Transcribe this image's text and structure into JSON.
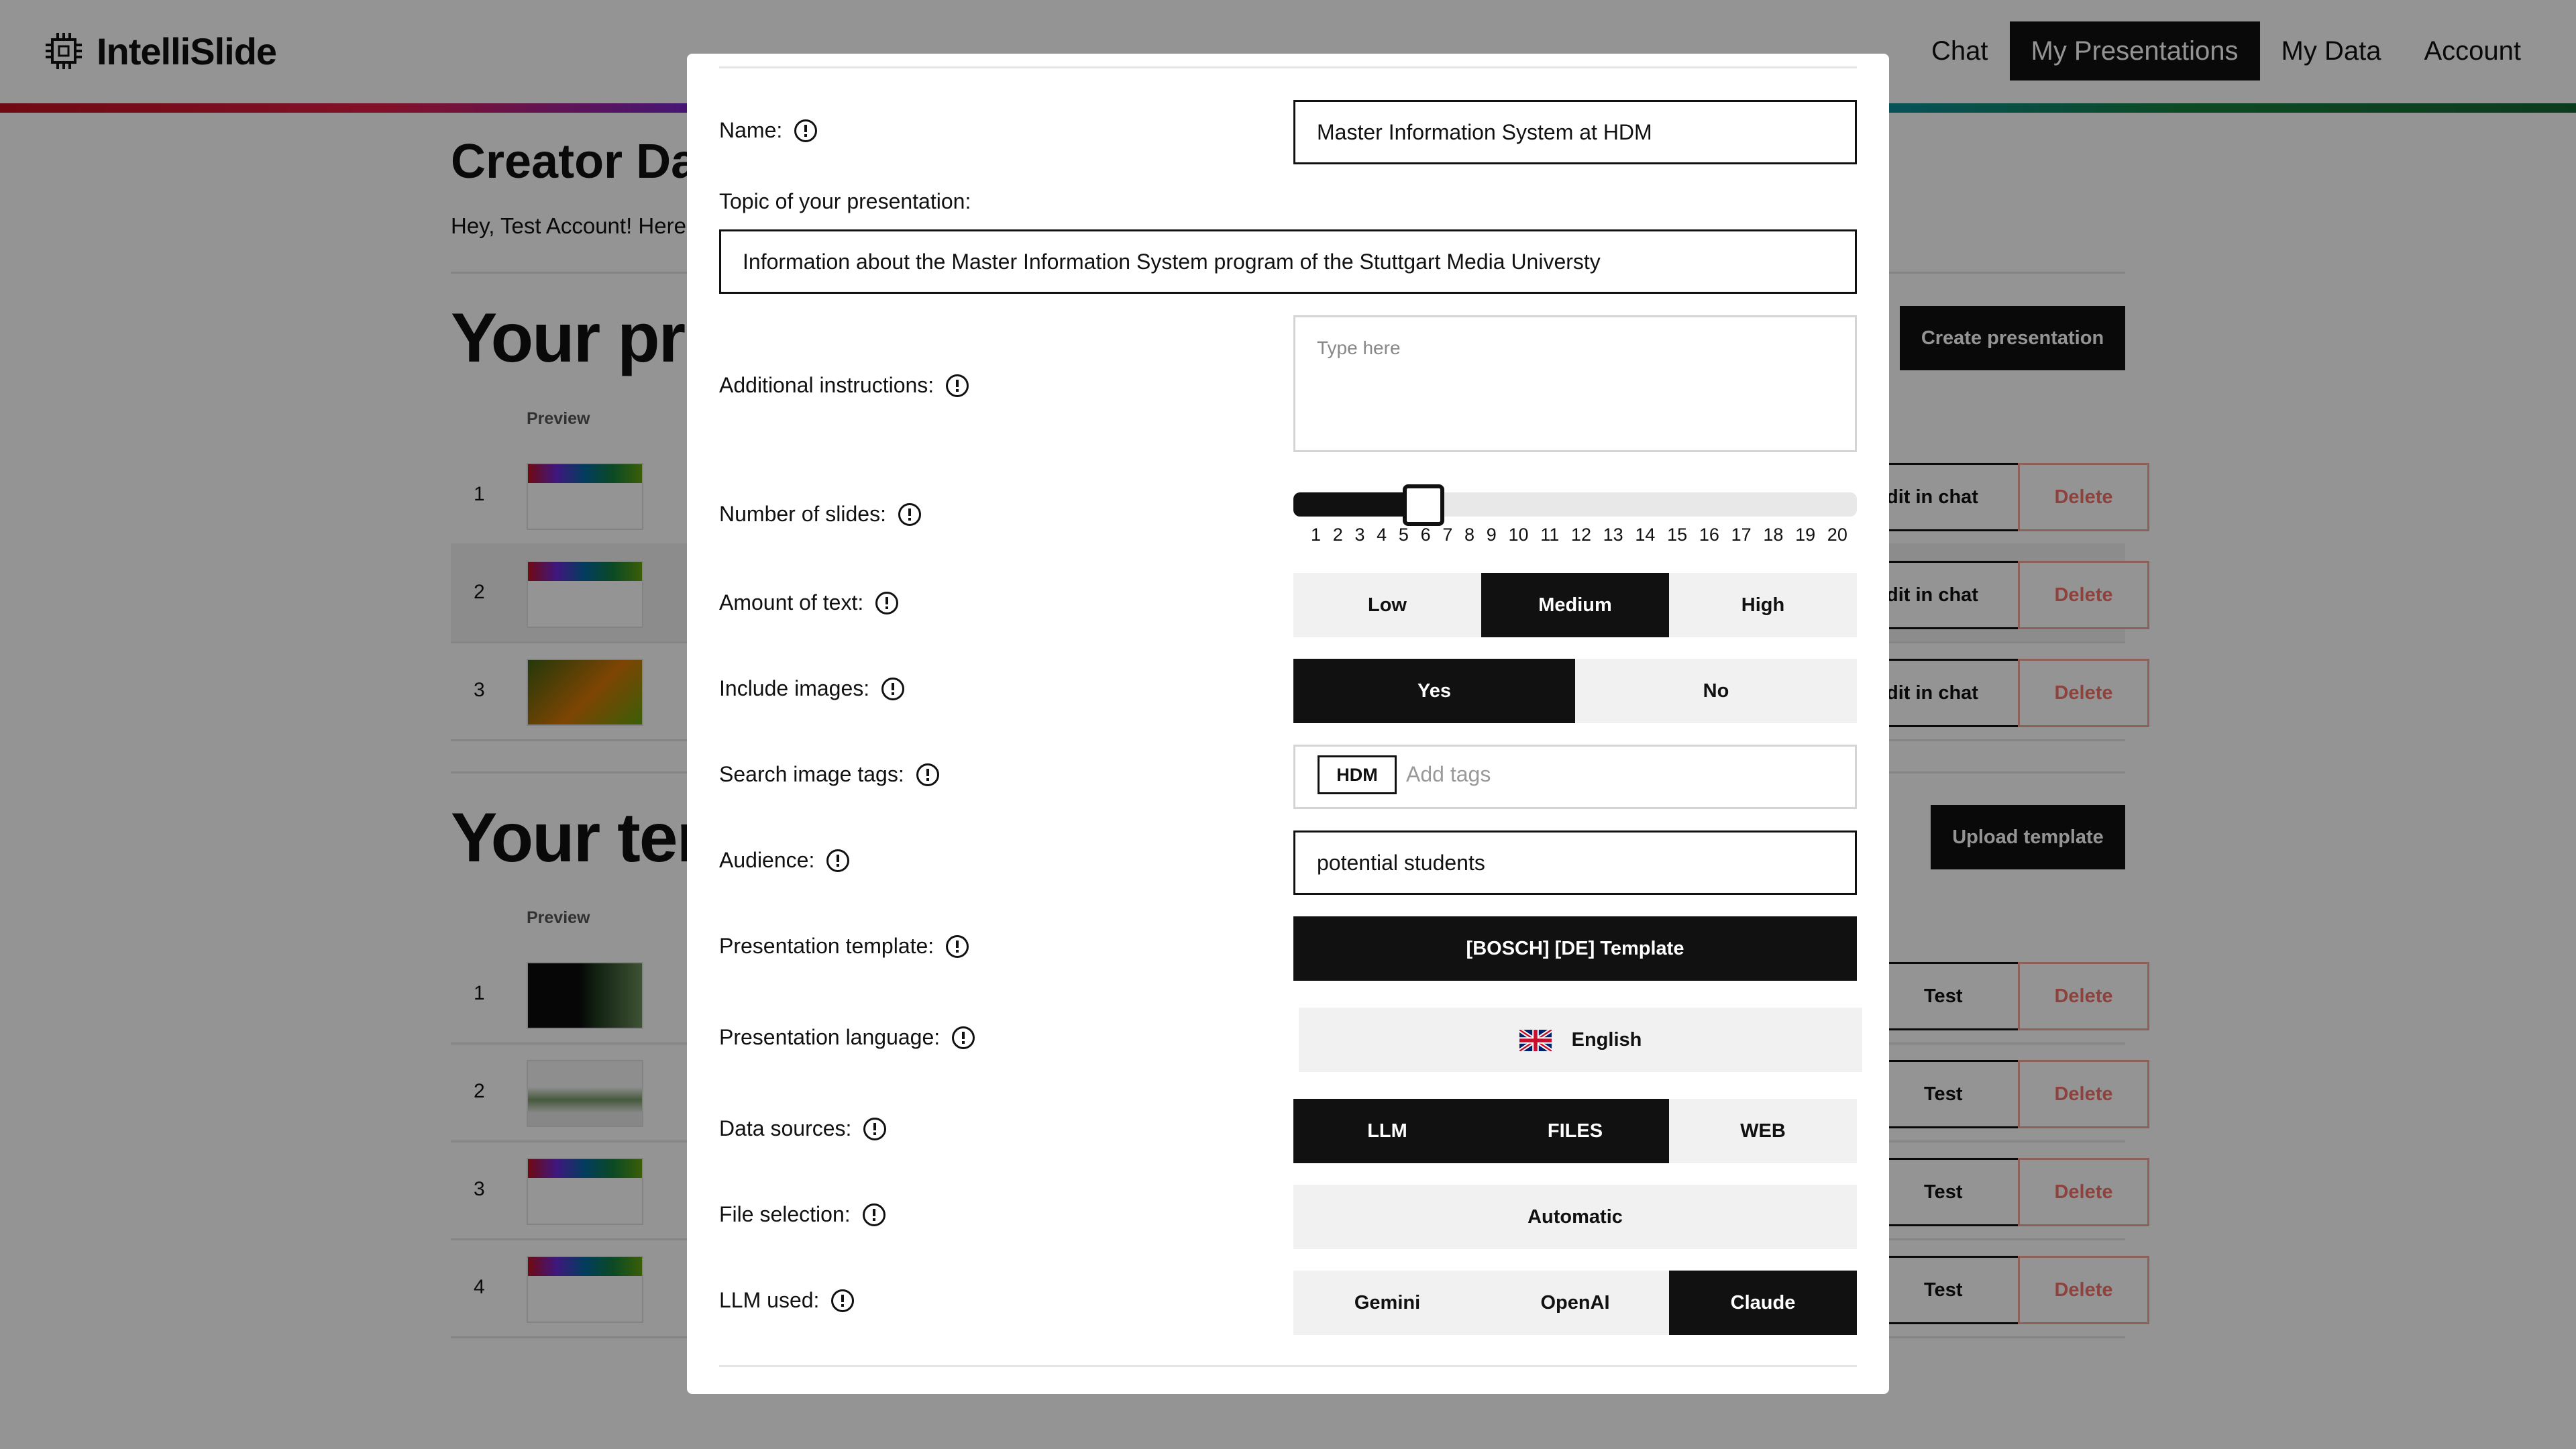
{
  "app": {
    "name": "IntelliSlide"
  },
  "nav": {
    "chat": "Chat",
    "my_presentations": "My Presentations",
    "my_data": "My Data",
    "account": "Account"
  },
  "page": {
    "title": "Creator Da",
    "greeting": "Hey, Test Account! Here",
    "presentations_title": "Your pre",
    "templates_title": "Your ten",
    "preview_header": "Preview",
    "create_button": "Create presentation",
    "upload_button": "Upload template",
    "edit_label": "dit in chat",
    "test_label": "Test",
    "delete_label": "Delete",
    "presentation_rows": [
      "1",
      "2",
      "3"
    ],
    "template_rows": [
      "1",
      "2",
      "3",
      "4"
    ]
  },
  "form": {
    "name": {
      "label": "Name:",
      "value": "Master Information System at HDM"
    },
    "topic": {
      "label": "Topic of your presentation:",
      "value": "Information about the Master Information System program of the Stuttgart Media Universty"
    },
    "instructions": {
      "label": "Additional instructions:",
      "placeholder": "Type here"
    },
    "slides": {
      "label": "Number of slides:",
      "value": 5,
      "min": 1,
      "max": 20,
      "ticks": [
        "1",
        "2",
        "3",
        "4",
        "5",
        "6",
        "7",
        "8",
        "9",
        "10",
        "11",
        "12",
        "13",
        "14",
        "15",
        "16",
        "17",
        "18",
        "19",
        "20"
      ]
    },
    "text_amount": {
      "label": "Amount of text:",
      "options": [
        "Low",
        "Medium",
        "High"
      ],
      "selected": "Medium"
    },
    "images": {
      "label": "Include images:",
      "options": [
        "Yes",
        "No"
      ],
      "selected": "Yes"
    },
    "image_tags": {
      "label": "Search image tags:",
      "tags": [
        "HDM"
      ],
      "placeholder": "Add tags"
    },
    "audience": {
      "label": "Audience:",
      "value": "potential students"
    },
    "template": {
      "label": "Presentation template:",
      "value": "[BOSCH] [DE] Template"
    },
    "language": {
      "label": "Presentation language:",
      "value": "English",
      "icon": "uk-flag-icon"
    },
    "data_sources": {
      "label": "Data sources:",
      "options": [
        "LLM",
        "FILES",
        "WEB"
      ],
      "selected": [
        "LLM",
        "FILES"
      ]
    },
    "file_selection": {
      "label": "File selection:",
      "value": "Automatic"
    },
    "llm": {
      "label": "LLM used:",
      "options": [
        "Gemini",
        "OpenAI",
        "Claude"
      ],
      "selected": "Claude"
    }
  }
}
